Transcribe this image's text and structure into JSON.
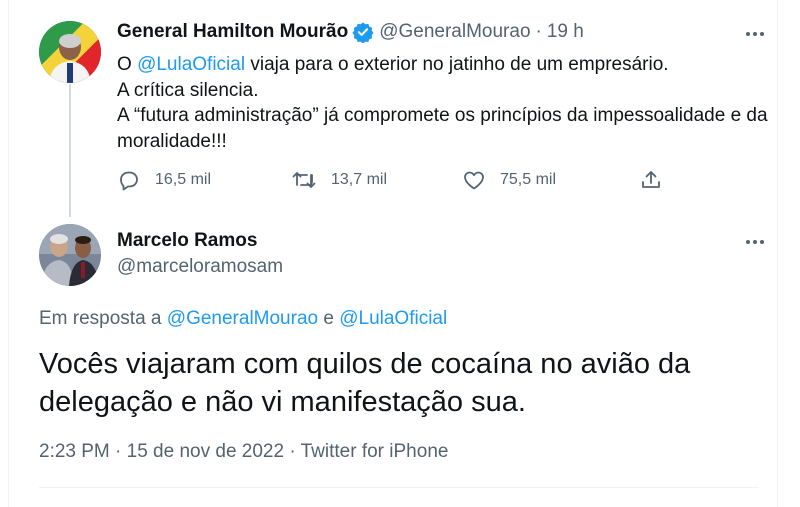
{
  "tweet1": {
    "author_name": "General Hamilton Mourão",
    "handle": "@GeneralMourao",
    "separator": "·",
    "time": "19 h",
    "line1_prefix": "O ",
    "line1_mention": "@LulaOficial",
    "line1_suffix": " viaja para o exterior no jatinho de um empresário.",
    "line2": "A crítica silencia.",
    "line3": "A “futura administração” já compromete os princípios da impessoalidade e da moralidade!!!",
    "replies": "16,5 mil",
    "retweets": "13,7 mil",
    "likes": "75,5 mil"
  },
  "tweet2": {
    "author_name": "Marcelo Ramos",
    "handle": "@marceloramosam",
    "reply_prefix": "Em resposta a ",
    "reply_mention1": "@GeneralMourao",
    "reply_joiner": " e ",
    "reply_mention2": "@LulaOficial",
    "text": "Vocês viajaram com quilos de cocaína no avião da delegação e não vi manifestação sua.",
    "meta": "2:23 PM · 15 de nov de 2022 · Twitter for iPhone"
  },
  "colors": {
    "accent": "#1d9bf0",
    "muted": "#536471",
    "text": "#0f1419"
  },
  "icons": [
    "more-icon",
    "verified-badge-icon",
    "reply-icon",
    "retweet-icon",
    "like-icon",
    "share-icon"
  ]
}
